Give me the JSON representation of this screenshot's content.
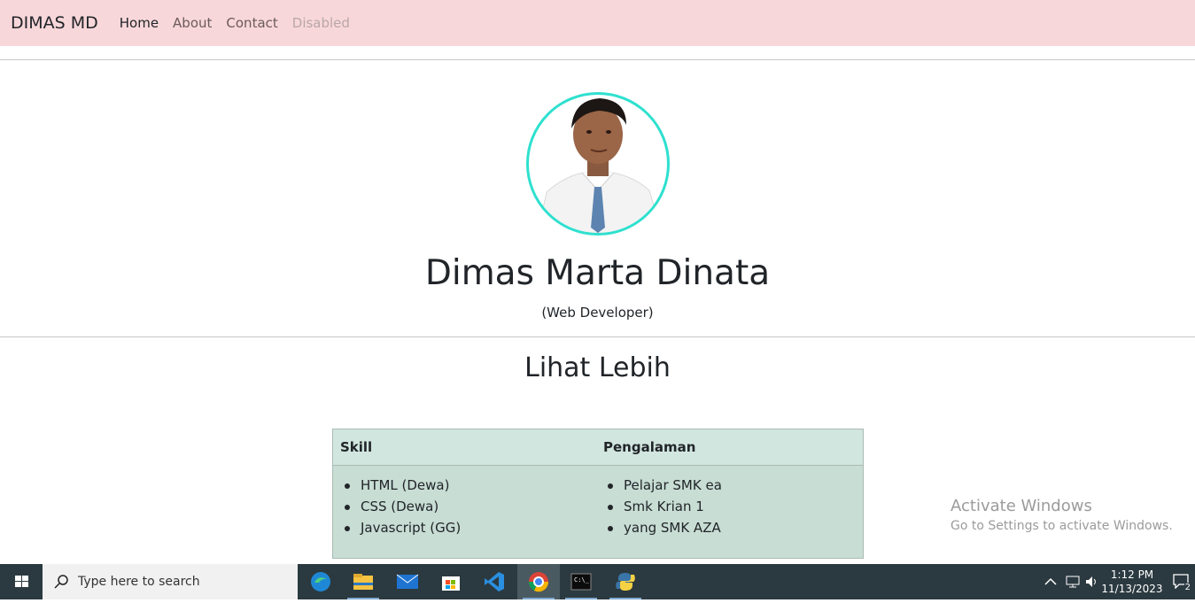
{
  "navbar": {
    "brand": "DIMAS MD",
    "links": [
      {
        "label": "Home",
        "state": "active"
      },
      {
        "label": "About",
        "state": "normal"
      },
      {
        "label": "Contact",
        "state": "normal"
      },
      {
        "label": "Disabled",
        "state": "disabled"
      }
    ]
  },
  "profile": {
    "name": "Dimas Marta Dinata",
    "role": "(Web Developer)"
  },
  "section": {
    "title": "Lihat Lebih"
  },
  "table": {
    "headers": [
      "Skill",
      "Pengalaman"
    ],
    "skills": [
      "HTML (Dewa)",
      "CSS (Dewa)",
      "Javascript (GG)"
    ],
    "experience": [
      "Pelajar SMK ea",
      "Smk Krian 1",
      "yang SMK AZA"
    ]
  },
  "watermark": {
    "title": "Activate Windows",
    "subtitle": "Go to Settings to activate Windows."
  },
  "taskbar": {
    "search_placeholder": "Type here to search",
    "time": "1:12 PM",
    "date": "11/13/2023",
    "notification_count": "2"
  },
  "colors": {
    "navbar_bg": "#f8d7da",
    "avatar_ring": "#2fe0cf",
    "table_bg": "#c8ddd4",
    "taskbar_bg": "#2b3a40"
  }
}
